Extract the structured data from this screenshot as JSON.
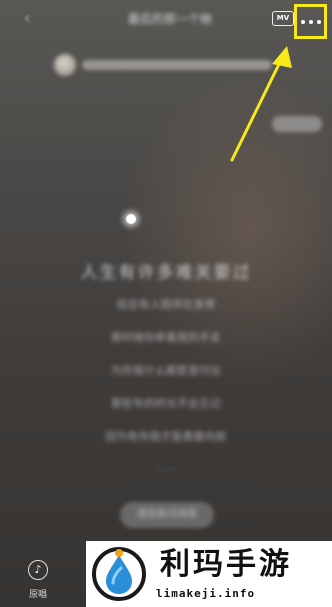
{
  "header": {
    "back_icon": "chevron-left-icon",
    "song_title": "最后的那一个她",
    "mv_label": "MV",
    "more_icon": "more-dots-icon"
  },
  "annotation": {
    "highlight_color": "#f6ea1a",
    "arrow_color": "#f6ea1a"
  },
  "lyrics": {
    "current": "人生有许多难关要过",
    "lines": [
      "但总有人陪伴在身旁",
      "那时候你牵着我的手走",
      "为你我什么都愿意付出",
      "那些年的时光不会忘记",
      "因为有你我才能勇敢向前",
      "……"
    ]
  },
  "bottom": {
    "original_icon": "music-note-icon",
    "original_label": "原唱",
    "center_pill_label": "播放歌词海报"
  },
  "watermark": {
    "title": "利玛手游",
    "domain": "limakeji.info",
    "logo": "water-drop-logo"
  }
}
